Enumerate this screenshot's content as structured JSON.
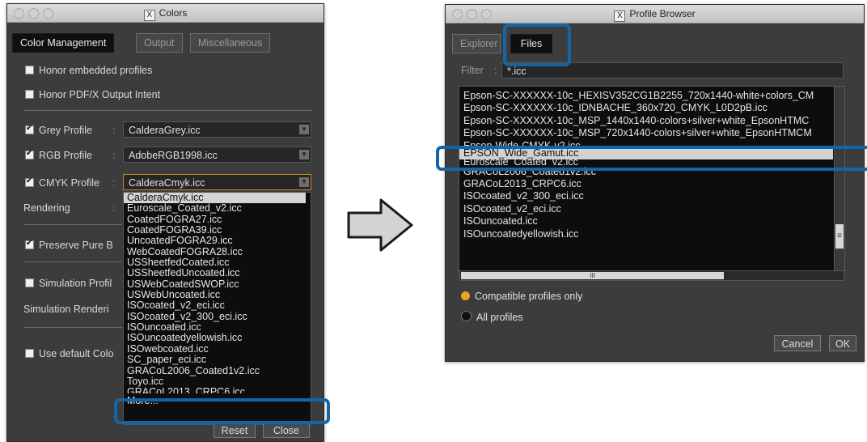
{
  "colors_window": {
    "title": "Colors",
    "title_icon": "X",
    "tabs": [
      "Color Management",
      "Output",
      "Miscellaneous"
    ],
    "honor_embedded": "Honor embedded profiles",
    "honor_pdfx": "Honor PDF/X Output Intent",
    "grey_label": "Grey Profile",
    "grey_value": "CalderaGrey.icc",
    "rgb_label": "RGB Profile",
    "rgb_value": "AdobeRGB1998.icc",
    "cmyk_label": "CMYK Profile",
    "cmyk_value": "CalderaCmyk.icc",
    "colon": ":",
    "rendering_label": "Rendering",
    "preserve_label": "Preserve Pure B",
    "simulation_label": "Simulation Profil",
    "simulation_rendering_label": "Simulation Renderi",
    "use_default_label": "Use default Colo",
    "dropdown_items": [
      "CalderaCmyk.icc",
      "Euroscale_Coated_v2.icc",
      "CoatedFOGRA27.icc",
      "CoatedFOGRA39.icc",
      "UncoatedFOGRA29.icc",
      "WebCoatedFOGRA28.icc",
      "USSheetfedCoated.icc",
      "USSheetfedUncoated.icc",
      "USWebCoatedSWOP.icc",
      "USWebUncoated.icc",
      "ISOcoated_v2_eci.icc",
      "ISOcoated_v2_300_eci.icc",
      "ISOuncoated.icc",
      "ISOuncoatedyellowish.icc",
      "ISOwebcoated.icc",
      "SC_paper_eci.icc",
      "GRACoL2006_Coated1v2.icc",
      "Toyo.icc",
      "GRACoL2013_CRPC6.icc"
    ],
    "more_label": "More...",
    "reset_label": "Reset",
    "close_label": "Close"
  },
  "arrow_icon": "right-arrow-icon",
  "profile_window": {
    "title": "Profile Browser",
    "title_icon": "X",
    "tabs": [
      "Explorer",
      "Files"
    ],
    "filter_label": "Filter",
    "filter_colon": ":",
    "filter_value": "*.icc",
    "files": [
      "Epson-SC-XXXXXX-10c_HEXISV352CG1B2255_720x1440-white+colors_CM",
      "Epson-SC-XXXXXX-10c_IDNBACHE_360x720_CMYK_L0D2pB.icc",
      "Epson-SC-XXXXXX-10c_MSP_1440x1440-colors+silver+white_EpsonHTMC",
      "Epson-SC-XXXXXX-10c_MSP_720x1440-colors+silver+white_EpsonHTMCM",
      "Epson-Wide-CMYK-v2.icc",
      "EPSON_Wide_Gamut.icc",
      "Euroscale_Coated_v2.icc",
      "GRACoL2006_Coated1v2.icc",
      "GRACoL2013_CRPC6.icc",
      "ISOcoated_v2_300_eci.icc",
      "ISOcoated_v2_eci.icc",
      "ISOuncoated.icc",
      "ISOuncoatedyellowish.icc"
    ],
    "selected_file_index": 5,
    "hscroll_label": "III",
    "vscroll_label": "≡",
    "compatible_label": "Compatible profiles only",
    "all_label": "All profiles",
    "cancel_label": "Cancel",
    "ok_label": "OK"
  },
  "colors": {
    "highlight": "#1565a6",
    "radio_selected": "#f0a020",
    "radio_unselected": "#111111"
  }
}
